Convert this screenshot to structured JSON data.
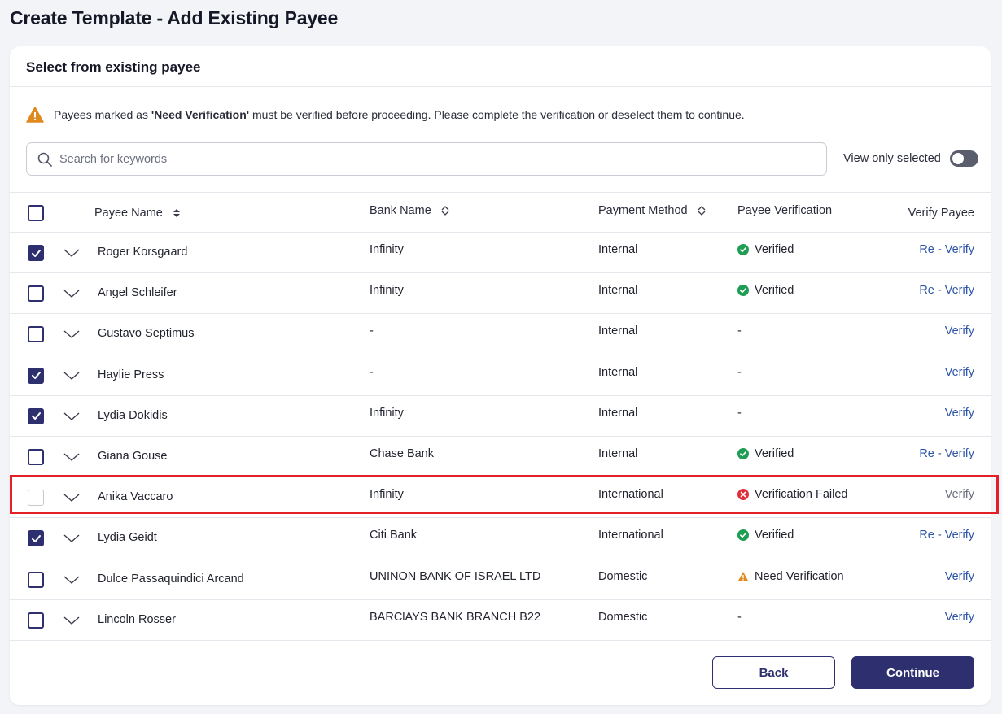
{
  "page": {
    "title": "Create Template - Add Existing Payee"
  },
  "card": {
    "header": "Select from existing payee"
  },
  "notice": {
    "prefix": "Payees marked as ",
    "bold": "'Need Verification'",
    "suffix": " must be verified before proceeding. Please complete the verification or deselect them to continue."
  },
  "search": {
    "placeholder": "Search for keywords",
    "value": ""
  },
  "view_only": {
    "label": "View only selected",
    "enabled": false
  },
  "table": {
    "headers": {
      "payee_name": "Payee Name",
      "bank_name": "Bank Name",
      "payment_method": "Payment Method",
      "payee_verification": "Payee Verification",
      "verify_payee": "Verify Payee"
    },
    "rows": [
      {
        "checked": true,
        "disabled": false,
        "name": "Roger Korsgaard",
        "bank": "Infinity",
        "method": "Internal",
        "verification": "Verified",
        "status": "verified",
        "action": "Re - Verify",
        "action_muted": false
      },
      {
        "checked": false,
        "disabled": false,
        "name": "Angel Schleifer",
        "bank": "Infinity",
        "method": "Internal",
        "verification": "Verified",
        "status": "verified",
        "action": "Re - Verify",
        "action_muted": false
      },
      {
        "checked": false,
        "disabled": false,
        "name": "Gustavo Septimus",
        "bank": "-",
        "method": "Internal",
        "verification": "-",
        "status": "none",
        "action": "Verify",
        "action_muted": false
      },
      {
        "checked": true,
        "disabled": false,
        "name": "Haylie Press",
        "bank": "-",
        "method": "Internal",
        "verification": "-",
        "status": "none",
        "action": "Verify",
        "action_muted": false
      },
      {
        "checked": true,
        "disabled": false,
        "name": "Lydia Dokidis",
        "bank": "Infinity",
        "method": "Internal",
        "verification": "-",
        "status": "none",
        "action": "Verify",
        "action_muted": false
      },
      {
        "checked": false,
        "disabled": false,
        "name": "Giana Gouse",
        "bank": "Chase Bank",
        "method": "Internal",
        "verification": "Verified",
        "status": "verified",
        "action": "Re - Verify",
        "action_muted": false
      },
      {
        "checked": false,
        "disabled": true,
        "name": "Anika Vaccaro",
        "bank": "Infinity",
        "method": "International",
        "verification": "Verification Failed",
        "status": "failed",
        "action": "Verify",
        "action_muted": true
      },
      {
        "checked": true,
        "disabled": false,
        "name": "Lydia Geidt",
        "bank": "Citi Bank",
        "method": "International",
        "verification": "Verified",
        "status": "verified",
        "action": "Re - Verify",
        "action_muted": false
      },
      {
        "checked": false,
        "disabled": false,
        "name": "Dulce Passaquindici Arcand",
        "bank": "UNINON BANK OF ISRAEL LTD",
        "method": "Domestic",
        "verification": "Need Verification",
        "status": "warning",
        "action": "Verify",
        "action_muted": false
      },
      {
        "checked": false,
        "disabled": false,
        "name": "Lincoln Rosser",
        "bank": "BARClAYS BANK BRANCH B22",
        "method": "Domestic",
        "verification": "-",
        "status": "none",
        "action": "Verify",
        "action_muted": false
      }
    ]
  },
  "buttons": {
    "back": "Back",
    "continue": "Continue"
  },
  "colors": {
    "primary": "#2d2f6e",
    "link": "#2d55a7",
    "verified": "#1f9d55",
    "failed": "#e0303a",
    "warning": "#e08a1e",
    "highlight": "#e32027"
  }
}
